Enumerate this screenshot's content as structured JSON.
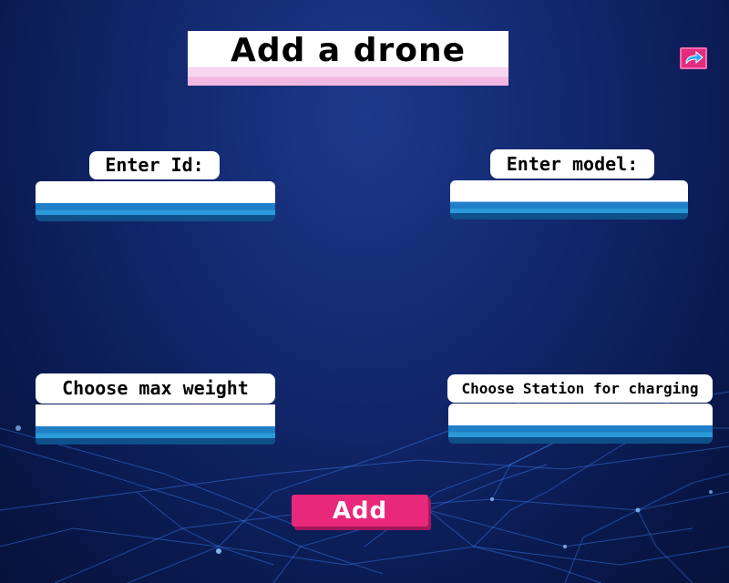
{
  "header": {
    "title": "Add a drone"
  },
  "form": {
    "id_label": "Enter Id:",
    "id_value": "",
    "model_label": "Enter model:",
    "model_value": "",
    "weight_label": "Choose max weight",
    "weight_value": "",
    "station_label": "Choose Station for charging",
    "station_value": ""
  },
  "actions": {
    "add_label": "Add",
    "back_icon": "redo-arrow-icon"
  },
  "colors": {
    "accent": "#e8287a",
    "field_blue": "#1f7fc7",
    "background": "#12286e"
  }
}
